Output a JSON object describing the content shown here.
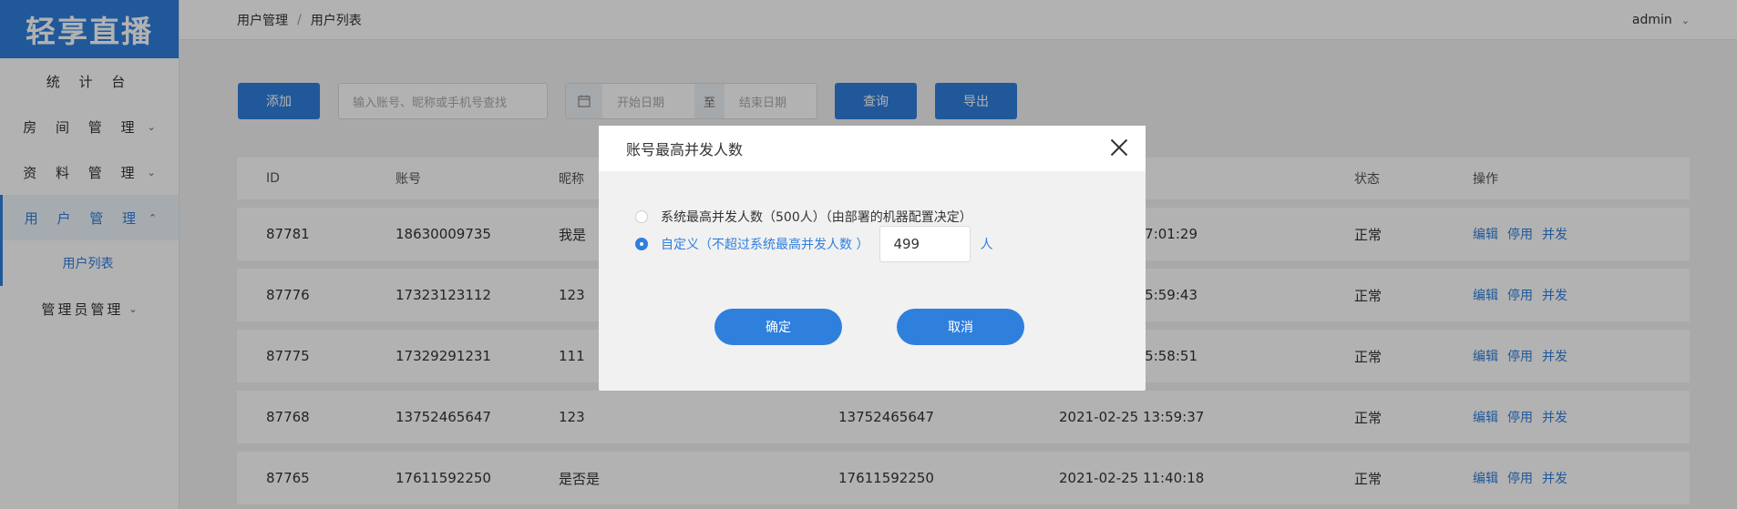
{
  "app": {
    "logo": "轻享直播"
  },
  "sidebar": {
    "items": [
      {
        "label": "统 计 台",
        "chevron": ""
      },
      {
        "label": "房 间 管 理",
        "chevron": "⌄"
      },
      {
        "label": "资 料 管 理",
        "chevron": "⌄"
      },
      {
        "label": "用 户 管 理",
        "chevron": "⌃"
      },
      {
        "label": "管理员管理",
        "chevron": "⌄"
      }
    ],
    "subitem": "用户列表"
  },
  "header": {
    "breadcrumb": [
      "用户管理",
      "用户列表"
    ],
    "separator": "/",
    "user": "admin",
    "user_chevron": "⌄"
  },
  "toolbar": {
    "add_label": "添加",
    "search_placeholder": "输入账号、昵称或手机号查找",
    "start_date_placeholder": "开始日期",
    "date_to": "至",
    "end_date_placeholder": "结束日期",
    "query_label": "查询",
    "export_label": "导出",
    "calendar_icon": "calendar-icon"
  },
  "table": {
    "headers": [
      "ID",
      "账号",
      "昵称",
      "",
      "",
      "状态",
      "操作"
    ],
    "rows": [
      {
        "id": "87781",
        "account": "18630009735",
        "nickname": "我是",
        "phone": "",
        "time": "17:01:29",
        "status": "正常"
      },
      {
        "id": "87776",
        "account": "17323123112",
        "nickname": "123",
        "phone": "",
        "time": "15:59:43",
        "status": "正常"
      },
      {
        "id": "87775",
        "account": "17329291231",
        "nickname": "111",
        "phone": "",
        "time": "15:58:51",
        "status": "正常"
      },
      {
        "id": "87768",
        "account": "13752465647",
        "nickname": "123",
        "phone": "13752465647",
        "time": "2021-02-25 13:59:37",
        "status": "正常"
      },
      {
        "id": "87765",
        "account": "17611592250",
        "nickname": "是否是",
        "phone": "17611592250",
        "time": "2021-02-25 11:40:18",
        "status": "正常"
      }
    ],
    "ops": [
      "编辑",
      "停用",
      "并发"
    ]
  },
  "modal": {
    "title": "账号最高并发人数",
    "option1": "系统最高并发人数（500人）（由部署的机器配置决定）",
    "option2": "自定义（不超过系统最高并发人数 ）",
    "value": "499",
    "unit": "人",
    "selected": "custom",
    "confirm_label": "确定",
    "cancel_label": "取消"
  },
  "colors": {
    "primary": "#2f7fdd",
    "overlay": "rgba(0,0,0,0.3)"
  }
}
